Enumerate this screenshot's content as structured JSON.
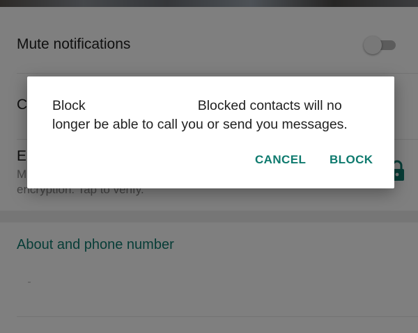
{
  "settings": {
    "mute": {
      "label": "Mute notifications",
      "toggle_on": false
    },
    "row_custom": {
      "label_partial": "C"
    },
    "encryption": {
      "title_partial": "E",
      "subtitle_line1_partial": "M",
      "subtitle_line2": "encryption. Tap to verify.",
      "icon": "lock-icon"
    },
    "about": {
      "label": "About and phone number"
    }
  },
  "dialog": {
    "message_start": "Block",
    "message_after_name": "Blocked contacts will no",
    "message_line2": "longer be able to call you or send you messages.",
    "cancel_label": "CANCEL",
    "block_label": "BLOCK"
  },
  "colors": {
    "accent": "#0e7a6e",
    "scrim": "rgba(0,0,0,0.5)",
    "background": "#ffffff"
  }
}
